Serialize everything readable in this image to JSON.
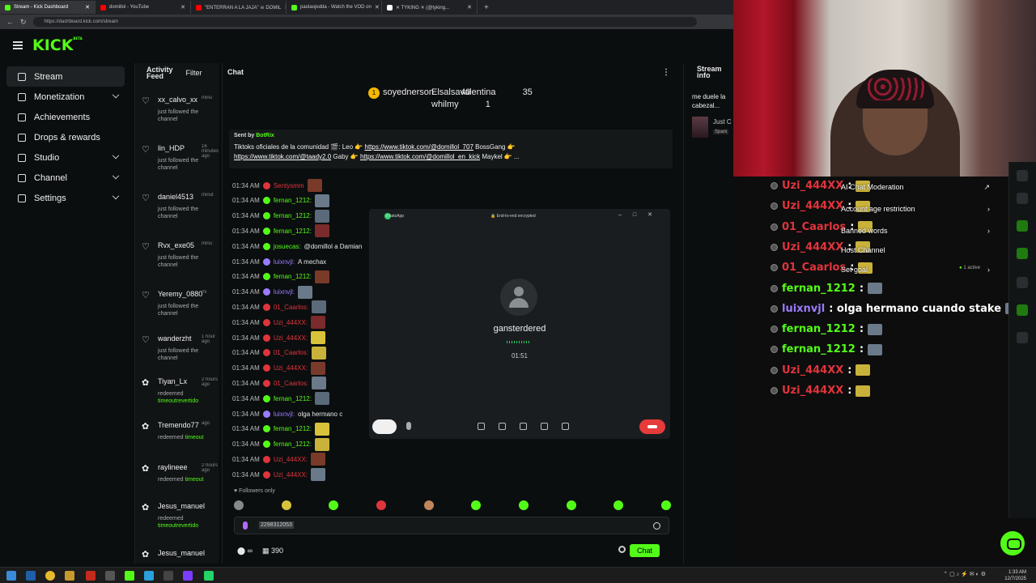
{
  "browser": {
    "tabs": [
      {
        "label": "Stream - Kick Dashboard",
        "color": "#53fc18",
        "active": true
      },
      {
        "label": "domillol - YouTube",
        "color": "#ff0000"
      },
      {
        "label": "\"ENTERRAN A LA JAJA\" ☠ DOMIL",
        "color": "#ff0000"
      },
      {
        "label": "paolaojedda - Watch the VOD on",
        "color": "#53fc18"
      },
      {
        "label": "✕ TYKING ✕ (@tyking...",
        "color": "#ffffff"
      }
    ],
    "url": "https://dashboard.kick.com/stream"
  },
  "header": {
    "logo": "KICK",
    "logo_tag": "BETA"
  },
  "leftnav": [
    {
      "label": "Stream",
      "active": true,
      "chevron": false
    },
    {
      "label": "Monetization",
      "chevron": true
    },
    {
      "label": "Achievements",
      "chevron": false
    },
    {
      "label": "Drops & rewards",
      "chevron": false
    },
    {
      "label": "Studio",
      "chevron": true
    },
    {
      "label": "Channel",
      "chevron": true
    },
    {
      "label": "Settings",
      "chevron": true
    }
  ],
  "activity": {
    "title_line1": "Activity",
    "title_line2": "Feed",
    "filter": "Filter",
    "items": [
      {
        "name": "xx_calvo_xx",
        "time": "minu",
        "desc": "just followed the channel",
        "icon": "heart-icon"
      },
      {
        "name": "lin_HDP",
        "time": "16 minutes ago",
        "desc": "just followed the channel",
        "icon": "heart-icon"
      },
      {
        "name": "daniel4513",
        "time": "minut",
        "desc": "just followed the channel",
        "icon": "heart-icon"
      },
      {
        "name": "Rvx_exe05",
        "time": "minu",
        "desc": "just followed the channel",
        "icon": "heart-icon"
      },
      {
        "name": "Yeremy_0880",
        "time": "mi",
        "desc": "just followed the channel",
        "icon": "heart-icon"
      },
      {
        "name": "wanderzht",
        "time": "1 hour ago",
        "desc": "just followed the channel",
        "icon": "heart-icon"
      },
      {
        "name": "Tiyan_Lx",
        "time": "2 hours ago",
        "desc": "redeemed",
        "desc_green": "timeoutrevertido",
        "icon": "reward-icon"
      },
      {
        "name": "Tremendo77",
        "time": "ago",
        "desc": "redeemed",
        "desc_green": "timeout",
        "icon": "reward-icon"
      },
      {
        "name": "raylineee",
        "time": "2 hours ago",
        "desc": "redeemed",
        "desc_green": "timeout",
        "icon": "reward-icon"
      },
      {
        "name": "Jesus_manuel",
        "time": "",
        "desc": "redeemed",
        "desc_green": "timeoutrevertido",
        "icon": "reward-icon"
      },
      {
        "name": "Jesus_manuel",
        "time": "",
        "desc": "",
        "icon": "reward-icon"
      }
    ]
  },
  "chat": {
    "title": "Chat",
    "leaders": [
      {
        "rank": "1",
        "name": "soyednerson",
        "count": "40"
      },
      {
        "name": "Elsalsavalentina",
        "count": "35"
      },
      {
        "name": "whilmy",
        "count": "1"
      }
    ],
    "pinned": {
      "sent_by": "Sent by",
      "bot": "BotRix",
      "text_1": "Tiktoks oficiales de la comunidad 🎬: Leo 👉",
      "link_1": "https://www.tiktok.com/@domillol_707",
      "text_2": "BossGang 👉",
      "link_2": "https://www.tiktok.com/@taady2.0",
      "text_3": "Gaby 👉",
      "link_3": "https://www.tiktok.com/@domillol_en_kick",
      "text_4": "Maykel 👉 ..."
    },
    "lines": [
      {
        "time": "01:34 AM",
        "user": "Sentysmm",
        "color": "#e0343c",
        "msg": ""
      },
      {
        "time": "01:34 AM",
        "user": "fernan_1212:",
        "color": "#53fc18",
        "msg": ""
      },
      {
        "time": "01:34 AM",
        "user": "fernan_1212:",
        "color": "#53fc18",
        "msg": ""
      },
      {
        "time": "01:34 AM",
        "user": "fernan_1212:",
        "color": "#53fc18",
        "msg": ""
      },
      {
        "time": "01:34 AM",
        "user": "josuecas:",
        "color": "#53fc18",
        "msg": "@domillol a Damian"
      },
      {
        "time": "01:34 AM",
        "user": "luixnvjl:",
        "color": "#9b7bff",
        "msg": "A mechax"
      },
      {
        "time": "01:34 AM",
        "user": "fernan_1212:",
        "color": "#53fc18",
        "msg": ""
      },
      {
        "time": "01:34 AM",
        "user": "luixnvjl:",
        "color": "#9b7bff",
        "msg": ""
      },
      {
        "time": "01:34 AM",
        "user": "01_Caarlos:",
        "color": "#e0343c",
        "msg": ""
      },
      {
        "time": "01:34 AM",
        "user": "Uzi_444XX:",
        "color": "#e0343c",
        "msg": ""
      },
      {
        "time": "01:34 AM",
        "user": "Uzi_444XX:",
        "color": "#e0343c",
        "msg": ""
      },
      {
        "time": "01:34 AM",
        "user": "01_Caarlos:",
        "color": "#e0343c",
        "msg": ""
      },
      {
        "time": "01:34 AM",
        "user": "Uzi_444XX:",
        "color": "#e0343c",
        "msg": ""
      },
      {
        "time": "01:34 AM",
        "user": "01_Caarlos:",
        "color": "#e0343c",
        "msg": ""
      },
      {
        "time": "01:34 AM",
        "user": "fernan_1212:",
        "color": "#53fc18",
        "msg": ""
      },
      {
        "time": "01:34 AM",
        "user": "luixnvjl:",
        "color": "#9b7bff",
        "msg": "olga hermano c"
      },
      {
        "time": "01:34 AM",
        "user": "fernan_1212:",
        "color": "#53fc18",
        "msg": ""
      },
      {
        "time": "01:34 AM",
        "user": "fernan_1212:",
        "color": "#53fc18",
        "msg": ""
      },
      {
        "time": "01:34 AM",
        "user": "Uzi_444XX:",
        "color": "#e0343c",
        "msg": ""
      },
      {
        "time": "01:34 AM",
        "user": "Uzi_444XX:",
        "color": "#e0343c",
        "msg": ""
      }
    ],
    "followers_only": "Followers only",
    "input_value": "2298312053",
    "points": "390",
    "chat_button": "Chat"
  },
  "whatsapp": {
    "app": "WhatsApp",
    "encrypted": "End-to-end encrypted",
    "caller": "gansterdered",
    "timer": "01:51"
  },
  "stream_info": {
    "title_line1": "Stream",
    "title_line2": "info",
    "note": "me duele la cabezal...",
    "just": "Just C",
    "lang": "Spani"
  },
  "overlay_chat": [
    {
      "user": "Uzi_444XX",
      "color": "#e0343c",
      "msg": ":"
    },
    {
      "user": "Uzi_444XX",
      "color": "#e0343c",
      "msg": ":"
    },
    {
      "user": "01_Caarlos",
      "color": "#e0343c",
      "msg": ":"
    },
    {
      "user": "Uzi_444XX",
      "color": "#e0343c",
      "msg": ":"
    },
    {
      "user": "01_Caarlos",
      "color": "#e0343c",
      "msg": ":"
    },
    {
      "user": "fernan_1212",
      "color": "#53fc18",
      "msg": ":"
    },
    {
      "user": "luixnvjl",
      "color": "#9b7bff",
      "msg": ": olga hermano cuando stake"
    },
    {
      "user": "fernan_1212",
      "color": "#53fc18",
      "msg": ":"
    },
    {
      "user": "fernan_1212",
      "color": "#53fc18",
      "msg": ":"
    },
    {
      "user": "Uzi_444XX",
      "color": "#e0343c",
      "msg": ":"
    },
    {
      "user": "Uzi_444XX",
      "color": "#e0343c",
      "msg": ":"
    }
  ],
  "dash_side": {
    "ai_mod": "AI Chat Moderation",
    "age": "Account age restriction",
    "banned": "Banned words",
    "host": "Host Channel",
    "set_goal": "Set goal",
    "active": "1 active"
  },
  "taskbar": {
    "time": "1:33 AM",
    "date": "12/7/2025"
  }
}
